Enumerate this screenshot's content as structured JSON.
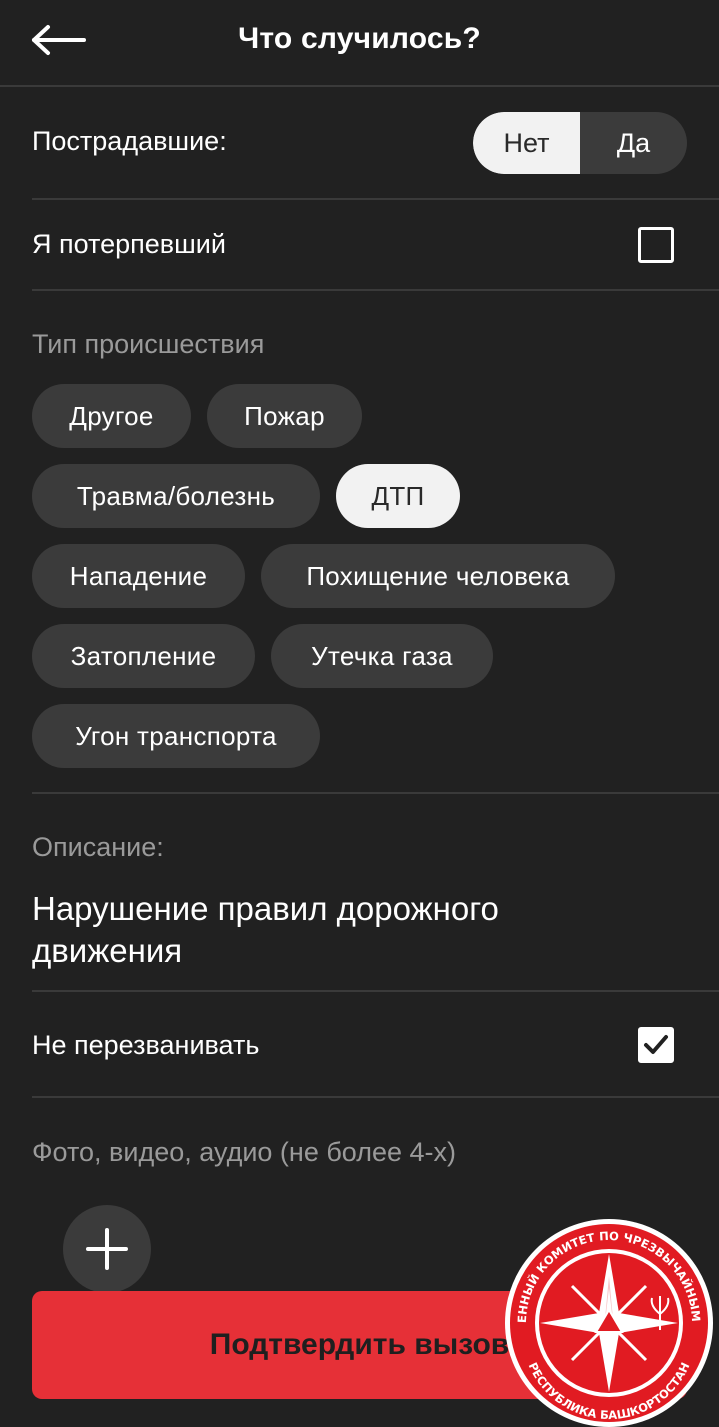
{
  "header": {
    "title": "Что случилось?",
    "back_icon": "arrow-left-icon"
  },
  "victims": {
    "label": "Пострадавшие:",
    "options": [
      "Нет",
      "Да"
    ],
    "selected": "Нет"
  },
  "i_am_victim": {
    "label": "Я потерпевший",
    "checked": false
  },
  "incident_type": {
    "label": "Тип происшествия",
    "chips": [
      {
        "label": "Другое",
        "selected": false
      },
      {
        "label": "Пожар",
        "selected": false
      },
      {
        "label": "Травма/болезнь",
        "selected": false
      },
      {
        "label": "ДТП",
        "selected": true
      },
      {
        "label": "Нападение",
        "selected": false
      },
      {
        "label": "Похищение человека",
        "selected": false
      },
      {
        "label": "Затопление",
        "selected": false
      },
      {
        "label": "Утечка газа",
        "selected": false
      },
      {
        "label": "Угон транспорта",
        "selected": false
      }
    ]
  },
  "description": {
    "label": "Описание:",
    "value": "Нарушение правил дорожного движения"
  },
  "no_callback": {
    "label": "Не перезванивать",
    "checked": true
  },
  "media": {
    "label": "Фото, видео, аудио (не более 4-х)",
    "add_icon": "plus-icon"
  },
  "confirm": {
    "label": "Подтвердить вызов"
  },
  "emblem": {
    "top_text": "ГОСУДАРСТВЕННЫЙ КОМИТЕТ ПО ЧРЕЗВЫЧАЙНЫМ СИТУАЦИЯМ",
    "bottom_text": "РЕСПУБЛИКА БАШКОРТОСТАН"
  },
  "colors": {
    "background": "#212121",
    "accent": "#e63037",
    "chip": "#3b3b3b",
    "chip_selected": "#f2f2f2"
  }
}
